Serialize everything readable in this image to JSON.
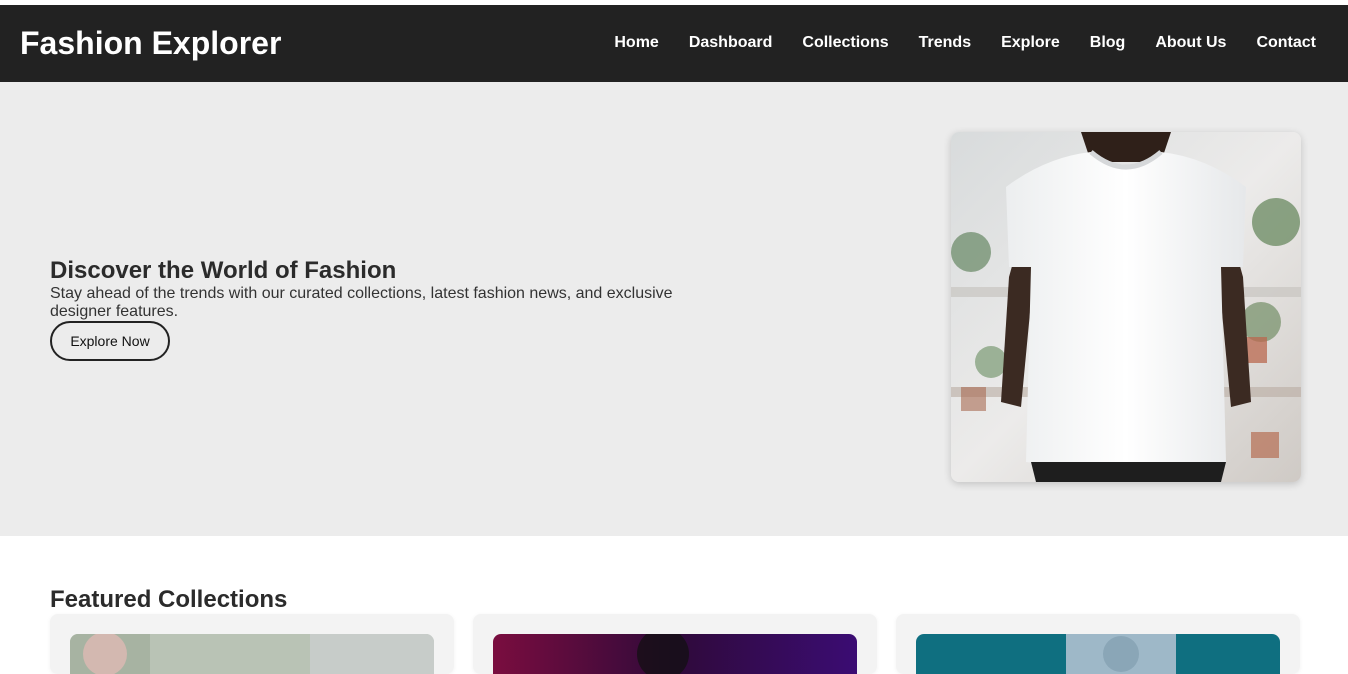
{
  "header": {
    "brand": "Fashion Explorer",
    "nav": [
      "Home",
      "Dashboard",
      "Collections",
      "Trends",
      "Explore",
      "Blog",
      "About Us",
      "Contact"
    ]
  },
  "hero": {
    "title": "Discover the World of Fashion",
    "text": "Stay ahead of the trends with our curated collections, latest fashion news, and exclusive designer features.",
    "button": "Explore Now",
    "image_icon": "white-tshirt-model-image"
  },
  "featured": {
    "title": "Featured Collections",
    "cards": [
      {
        "image_icon": "collection-image-1"
      },
      {
        "image_icon": "collection-image-2"
      },
      {
        "image_icon": "collection-image-3"
      }
    ]
  },
  "colors": {
    "nav_bg": "#222222",
    "hero_bg": "#ececec",
    "text": "#333333"
  }
}
